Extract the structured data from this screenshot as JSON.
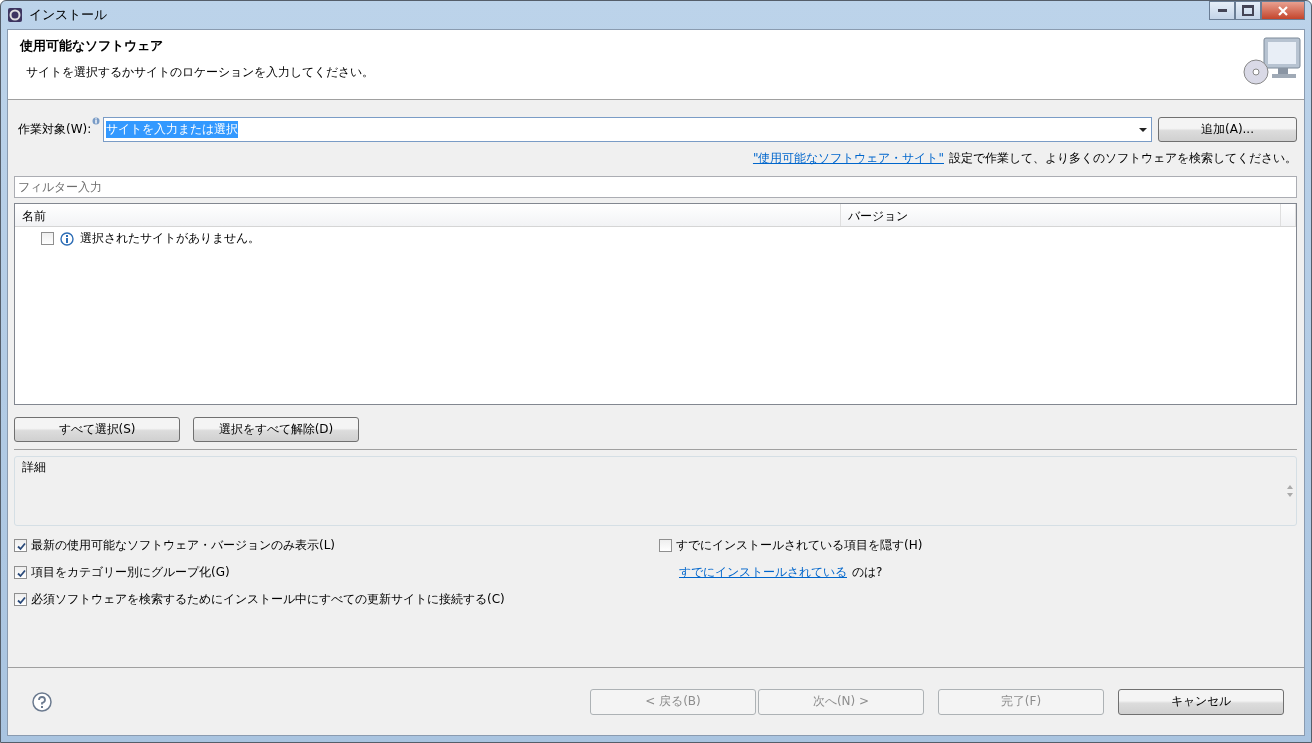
{
  "window": {
    "title": "インストール"
  },
  "header": {
    "title": "使用可能なソフトウェア",
    "description": "サイトを選択するかサイトのロケーションを入力してください。"
  },
  "work_with": {
    "label": "作業対象(W):",
    "value": "サイトを入力または選択",
    "value_selected": true,
    "add_button": "追加(A)..."
  },
  "sites_hint": {
    "link": "\"使用可能なソフトウェア・サイト\"",
    "text": "設定で作業して、より多くのソフトウェアを検索してください。"
  },
  "filter": {
    "placeholder": "フィルター入力"
  },
  "table": {
    "columns": [
      "名前",
      "バージョン"
    ],
    "rows": [
      {
        "name": "選択されたサイトがありません。",
        "checked": false
      }
    ]
  },
  "selection_buttons": [
    "すべて選択(S)",
    "選択をすべて解除(D)"
  ],
  "details": {
    "label": "詳細"
  },
  "options_left": [
    {
      "label": "最新の使用可能なソフトウェア・バージョンのみ表示(L)",
      "checked": true
    },
    {
      "label": "項目をカテゴリー別にグループ化(G)",
      "checked": true
    },
    {
      "label": "必須ソフトウェアを検索するためにインストール中にすべての更新サイトに接続する(C)",
      "checked": true
    }
  ],
  "options_right": [
    {
      "kind": "checkbox",
      "label": "すでにインストールされている項目を隠す(H)",
      "checked": false
    },
    {
      "kind": "link",
      "link": "すでにインストールされている",
      "text": "のは?"
    }
  ],
  "footer": {
    "buttons": [
      {
        "label": "< 戻る(B)",
        "disabled": true
      },
      {
        "label": "次へ(N) >",
        "disabled": true
      },
      {
        "label": "完了(F)",
        "disabled": true
      },
      {
        "label": "キャンセル",
        "disabled": false
      }
    ]
  }
}
